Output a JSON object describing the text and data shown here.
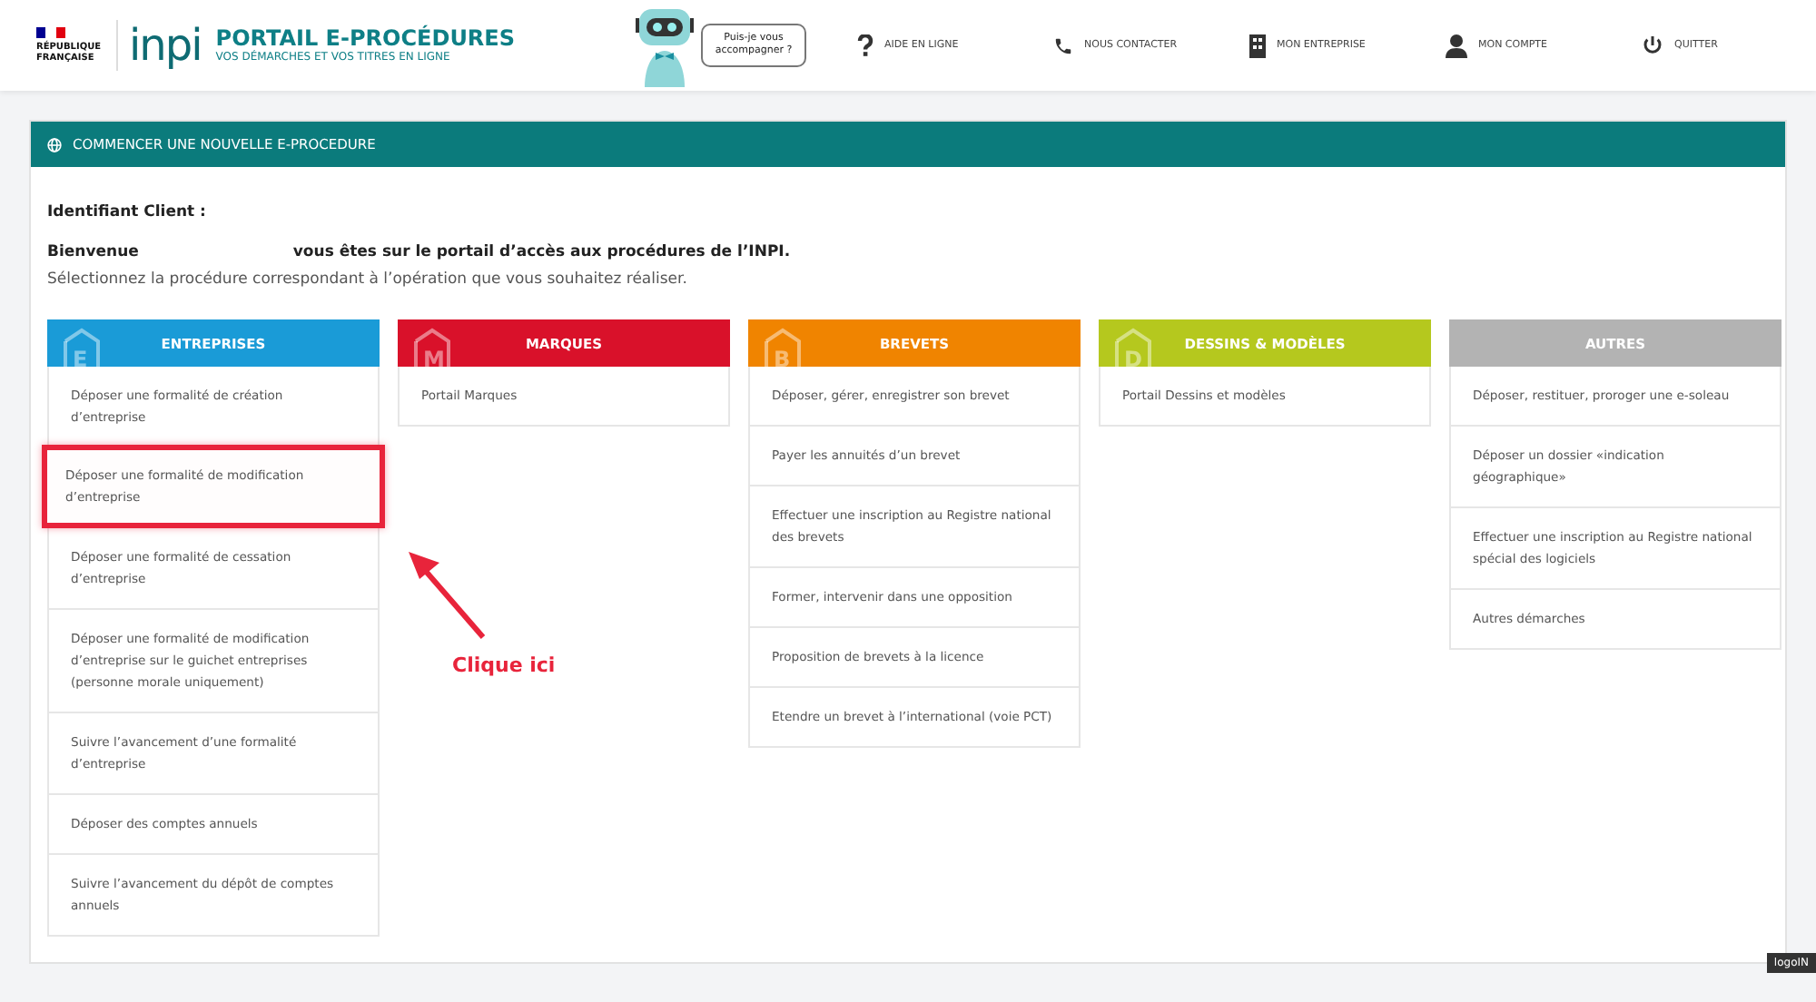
{
  "header": {
    "republic": "RÉPUBLIQUE FRANÇAISE",
    "logo": "inpi",
    "title": "PORTAIL E-PROCÉDURES",
    "subtitle": "VOS DÉMARCHES ET VOS TITRES EN LIGNE",
    "assistant_bubble": "Puis-je vous accompagner ?",
    "nav": [
      {
        "kind": "help",
        "label": "AIDE EN LIGNE"
      },
      {
        "kind": "phone",
        "label": "NOUS CONTACTER"
      },
      {
        "kind": "building",
        "label": "MON ENTREPRISE"
      },
      {
        "kind": "user",
        "label": "MON COMPTE"
      },
      {
        "kind": "power",
        "label": "QUITTER"
      }
    ]
  },
  "panel": {
    "title": "COMMENCER UNE NOUVELLE E-PROCEDURE",
    "client_id_label": "Identifiant Client :",
    "welcome": "Bienvenue",
    "welcome_rest": "vous êtes sur le portail d’accès aux procédures de l’INPI.",
    "instruction": "Sélectionnez la procédure correspondant à l’opération que vous souhaitez réaliser.",
    "columns": [
      {
        "title": "ENTREPRISES",
        "badge": "E",
        "color": "#1a9bd7",
        "items": [
          {
            "label": "Déposer une formalité de création d’entreprise",
            "highlighted": false
          },
          {
            "label": "Déposer une formalité de modification d’entreprise",
            "highlighted": true
          },
          {
            "label": "Déposer une formalité de cessation d’entreprise",
            "highlighted": false
          },
          {
            "label": "Déposer une formalité de modification d’entreprise sur le guichet entreprises (personne morale uniquement)",
            "highlighted": false
          },
          {
            "label": "Suivre l’avancement d’une formalité d’entreprise",
            "highlighted": false
          },
          {
            "label": "Déposer des comptes annuels",
            "highlighted": false
          },
          {
            "label": "Suivre l’avancement du dépôt de comptes annuels",
            "highlighted": false
          }
        ]
      },
      {
        "title": "MARQUES",
        "badge": "M",
        "color": "#d9112a",
        "items": [
          {
            "label": "Portail Marques",
            "highlighted": false
          }
        ]
      },
      {
        "title": "BREVETS",
        "badge": "B",
        "color": "#f08400",
        "items": [
          {
            "label": "Déposer, gérer, enregistrer son brevet",
            "highlighted": false
          },
          {
            "label": "Payer les annuités d’un brevet",
            "highlighted": false
          },
          {
            "label": "Effectuer une inscription au Registre national des brevets",
            "highlighted": false
          },
          {
            "label": "Former, intervenir dans une opposition",
            "highlighted": false
          },
          {
            "label": "Proposition de brevets à la licence",
            "highlighted": false
          },
          {
            "label": "Etendre un brevet à l’international (voie PCT)",
            "highlighted": false
          }
        ]
      },
      {
        "title": "DESSINS & MODÈLES",
        "badge": "D",
        "color": "#b5c81e",
        "items": [
          {
            "label": "Portail Dessins et modèles",
            "highlighted": false
          }
        ]
      },
      {
        "title": "AUTRES",
        "color": "#b3b3b3",
        "items": [
          {
            "label": "Déposer, restituer, proroger une e-soleau",
            "highlighted": false
          },
          {
            "label": "Déposer un dossier «indication géographique»",
            "highlighted": false
          },
          {
            "label": "Effectuer une inscription au Registre national spécial des logiciels",
            "highlighted": false
          },
          {
            "label": "Autres démarches",
            "highlighted": false
          }
        ]
      }
    ]
  },
  "annotation": {
    "text": "Clique ici"
  },
  "tooltip": "logoIN"
}
